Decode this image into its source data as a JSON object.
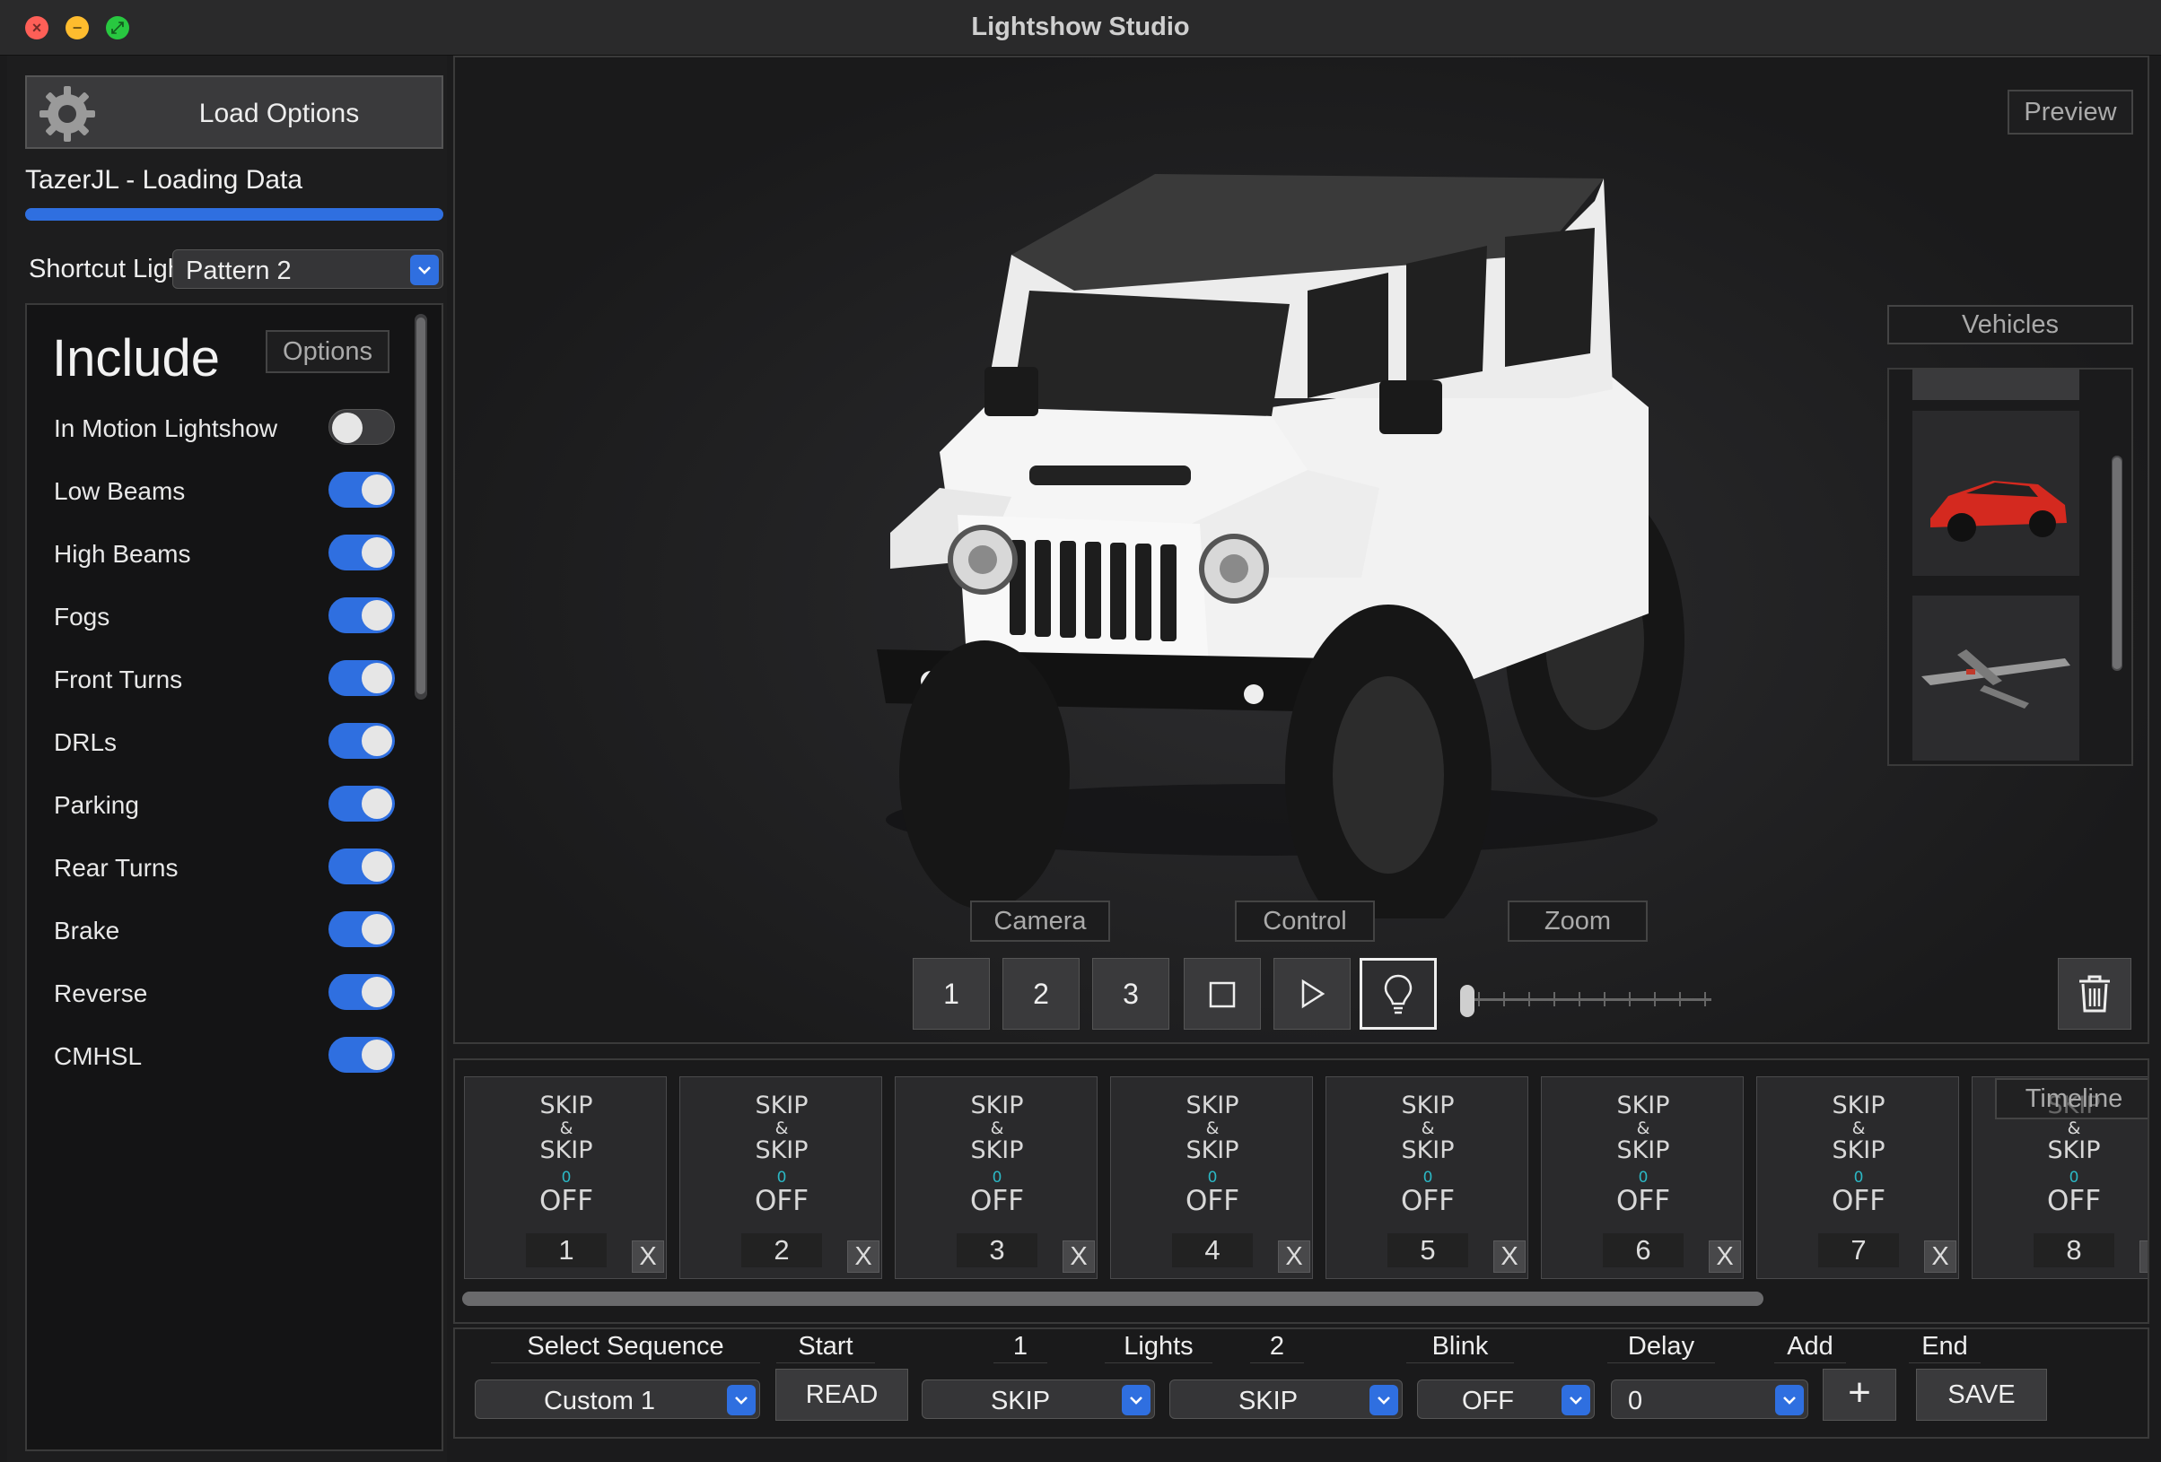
{
  "window": {
    "title": "Lightshow Studio"
  },
  "left_panel": {
    "load_button": "Load Options",
    "status": "TazerJL - Loading Data",
    "progress_fraction": 1.0,
    "shortcut": {
      "label": "Shortcut Lightshow",
      "selected": "Pattern 2"
    },
    "include": {
      "title": "Include",
      "options_button": "Options",
      "toggles": [
        {
          "label": "In Motion Lightshow",
          "on": false
        },
        {
          "label": "Low Beams",
          "on": true
        },
        {
          "label": "High Beams",
          "on": true
        },
        {
          "label": "Fogs",
          "on": true
        },
        {
          "label": "Front Turns",
          "on": true
        },
        {
          "label": "DRLs",
          "on": true
        },
        {
          "label": "Parking",
          "on": true
        },
        {
          "label": "Rear Turns",
          "on": true
        },
        {
          "label": "Brake",
          "on": true
        },
        {
          "label": "Reverse",
          "on": true
        },
        {
          "label": "CMHSL",
          "on": true
        }
      ]
    }
  },
  "viewport": {
    "preview_label": "Preview",
    "vehicles_label": "Vehicles",
    "camera_label": "Camera",
    "control_label": "Control",
    "zoom_label": "Zoom",
    "camera_buttons": [
      "1",
      "2",
      "3"
    ],
    "zoom_fraction": 0.0
  },
  "timeline": {
    "label": "Timeline",
    "cards": [
      {
        "top": "SKIP",
        "amp": "&",
        "bottom": "SKIP",
        "delay": "0",
        "blink": "OFF",
        "index": "1",
        "remove": "X"
      },
      {
        "top": "SKIP",
        "amp": "&",
        "bottom": "SKIP",
        "delay": "0",
        "blink": "OFF",
        "index": "2",
        "remove": "X"
      },
      {
        "top": "SKIP",
        "amp": "&",
        "bottom": "SKIP",
        "delay": "0",
        "blink": "OFF",
        "index": "3",
        "remove": "X"
      },
      {
        "top": "SKIP",
        "amp": "&",
        "bottom": "SKIP",
        "delay": "0",
        "blink": "OFF",
        "index": "4",
        "remove": "X"
      },
      {
        "top": "SKIP",
        "amp": "&",
        "bottom": "SKIP",
        "delay": "0",
        "blink": "OFF",
        "index": "5",
        "remove": "X"
      },
      {
        "top": "SKIP",
        "amp": "&",
        "bottom": "SKIP",
        "delay": "0",
        "blink": "OFF",
        "index": "6",
        "remove": "X"
      },
      {
        "top": "SKIP",
        "amp": "&",
        "bottom": "SKIP",
        "delay": "0",
        "blink": "OFF",
        "index": "7",
        "remove": "X"
      },
      {
        "top": "SKIP",
        "amp": "&",
        "bottom": "SKIP",
        "delay": "0",
        "blink": "OFF",
        "index": "8",
        "remove": "X"
      }
    ]
  },
  "sequence_bar": {
    "select_sequence_label": "Select Sequence",
    "start_label": "Start",
    "lights1_label": "1",
    "lights_label": "Lights",
    "lights2_label": "2",
    "blink_label": "Blink",
    "delay_label": "Delay",
    "add_label": "Add",
    "end_label": "End",
    "sequence_value": "Custom 1",
    "read_button": "READ",
    "lights1_value": "SKIP",
    "lights2_value": "SKIP",
    "blink_value": "OFF",
    "delay_value": "0",
    "add_button": "+",
    "save_button": "SAVE"
  },
  "colors": {
    "accent": "#2f6fe0",
    "delay_text": "#2bb7c4",
    "background": "#1b1b1c"
  }
}
